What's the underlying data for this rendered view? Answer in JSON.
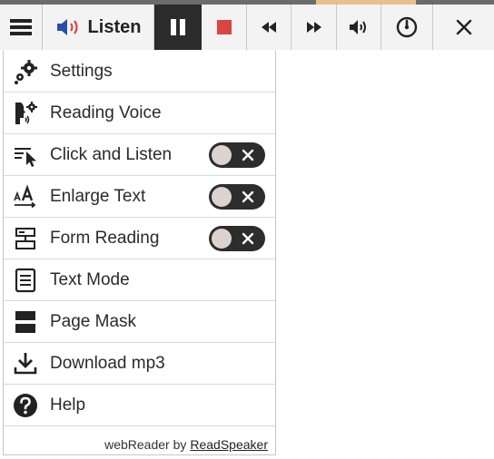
{
  "toolbar": {
    "listen_label": "Listen",
    "progress_fraction": 0.2,
    "buttons": [
      {
        "name": "menu",
        "icon": "hamburger-icon"
      },
      {
        "name": "listen",
        "icon": "speaker-icon"
      },
      {
        "name": "pause",
        "icon": "pause-icon"
      },
      {
        "name": "stop",
        "icon": "stop-icon"
      },
      {
        "name": "rewind",
        "icon": "rewind-icon"
      },
      {
        "name": "fast-forward",
        "icon": "fast-forward-icon"
      },
      {
        "name": "volume",
        "icon": "volume-icon"
      },
      {
        "name": "speed",
        "icon": "speedometer-icon"
      },
      {
        "name": "close",
        "icon": "close-icon"
      }
    ],
    "colors": {
      "stop": "#d9453f",
      "pause_bg": "#2b2b2b",
      "listen_speaker": "#2a4fa8",
      "listen_waves": "#d9453f",
      "progress": "#e8bf8e"
    }
  },
  "menu": {
    "items": [
      {
        "label": "Settings",
        "icon": "gears-icon"
      },
      {
        "label": "Reading Voice",
        "icon": "voice-head-icon"
      },
      {
        "label": "Click and Listen",
        "icon": "text-cursor-icon",
        "toggle": false
      },
      {
        "label": "Enlarge Text",
        "icon": "enlarge-text-icon",
        "toggle": false
      },
      {
        "label": "Form Reading",
        "icon": "form-icon",
        "toggle": false
      },
      {
        "label": "Text Mode",
        "icon": "document-icon"
      },
      {
        "label": "Page Mask",
        "icon": "page-mask-icon"
      },
      {
        "label": "Download mp3",
        "icon": "download-icon"
      },
      {
        "label": "Help",
        "icon": "help-icon"
      }
    ],
    "footer_prefix": "webReader by",
    "footer_brand": "ReadSpeaker"
  }
}
